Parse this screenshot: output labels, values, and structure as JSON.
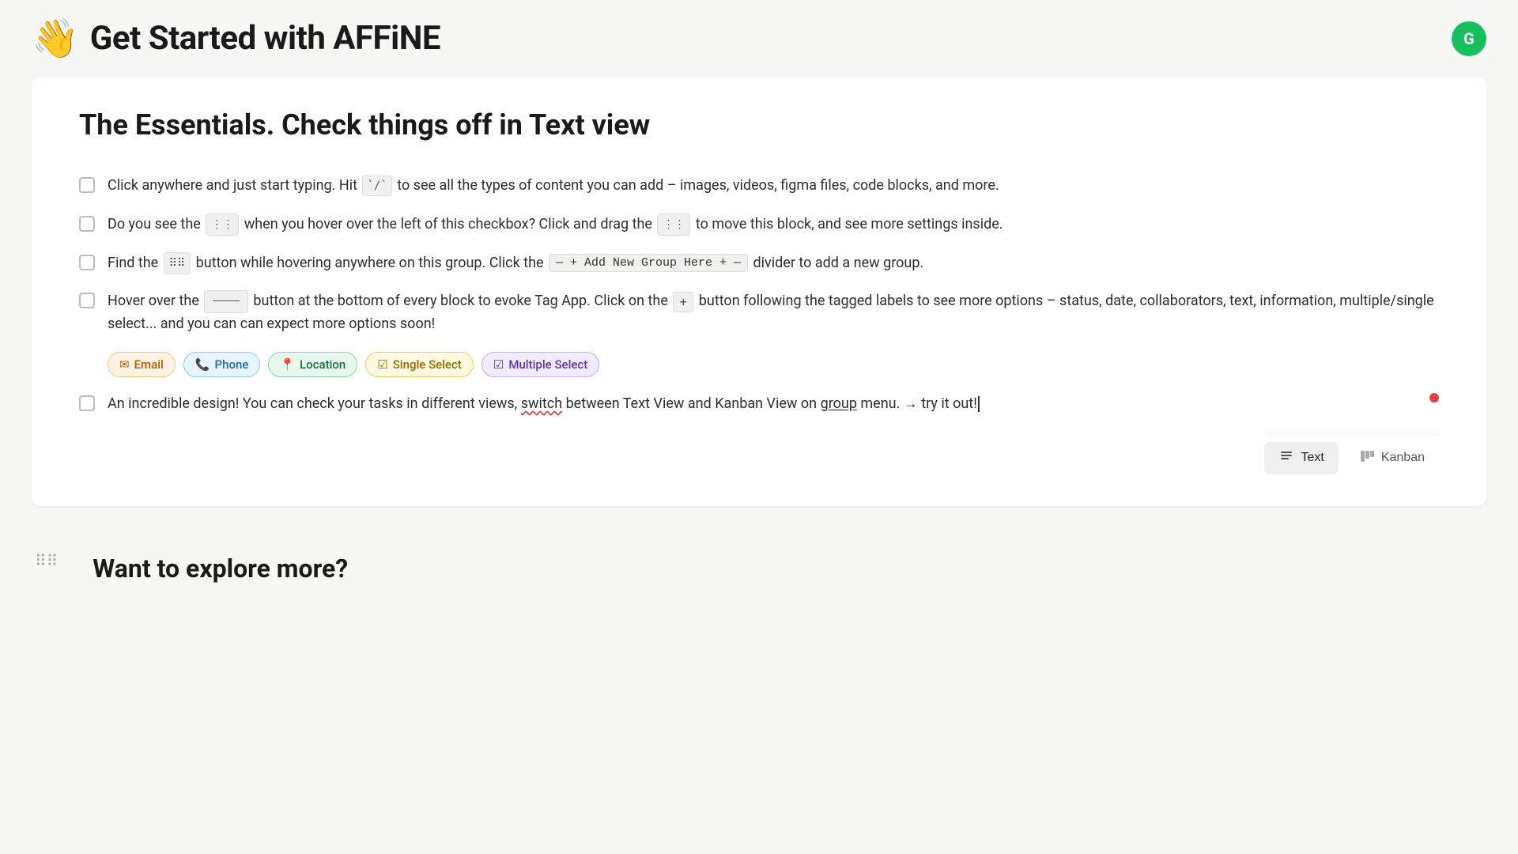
{
  "header": {
    "emoji": "👋",
    "title": "Get Started with AFFiNE",
    "grammarly_label": "G"
  },
  "section": {
    "title": "The Essentials. Check things off in Text view",
    "items": [
      {
        "id": "item-1",
        "text": "Click anywhere and just start typing. Hit `/` to see all the types of content you can add – images, videos, figma files, code blocks, and more.",
        "checked": false
      },
      {
        "id": "item-2",
        "text_parts": [
          "Do you see the",
          "⋮⋮⋮",
          "when you hover over the left of this checkbox? Click and drag the",
          "⋮⋮⋮",
          "to move this block, and see more settings inside."
        ],
        "checked": false
      },
      {
        "id": "item-3",
        "text_before": "Find the",
        "icon_label": "⠿",
        "text_after_icon": "button while hovering anywhere on this group. Click the",
        "code1": "— + Add New Group Here + —",
        "text_end": "divider to add a new group.",
        "checked": false
      },
      {
        "id": "item-4",
        "text": "Hover over the",
        "dash_btn": "————",
        "text2": "button at the bottom of every block to evoke Tag App. Click on the",
        "plus_btn": "+",
        "text3": "button following the tagged labels to see more options – status, date, collaborators, text, information, multiple/single select... and you can can expect more options soon!",
        "checked": false
      },
      {
        "id": "item-5",
        "text": "An incredible design! You can check your tasks in different views,",
        "link_text": "switch",
        "text2": "between Text View and Kanban View on",
        "underline_text": "group",
        "text3": "menu. → try it out!",
        "checked": false
      }
    ],
    "tags": [
      {
        "label": "Email",
        "type": "email",
        "icon": "✉"
      },
      {
        "label": "Phone",
        "type": "phone",
        "icon": "📞"
      },
      {
        "label": "Location",
        "type": "location",
        "icon": "📍"
      },
      {
        "label": "Single Select",
        "type": "single",
        "icon": "☑"
      },
      {
        "label": "Multiple Select",
        "type": "multiple",
        "icon": "☑"
      }
    ]
  },
  "toolbar": {
    "text_label": "Text",
    "kanban_label": "Kanban"
  },
  "next_section": {
    "hint": "Want to explore more?"
  }
}
